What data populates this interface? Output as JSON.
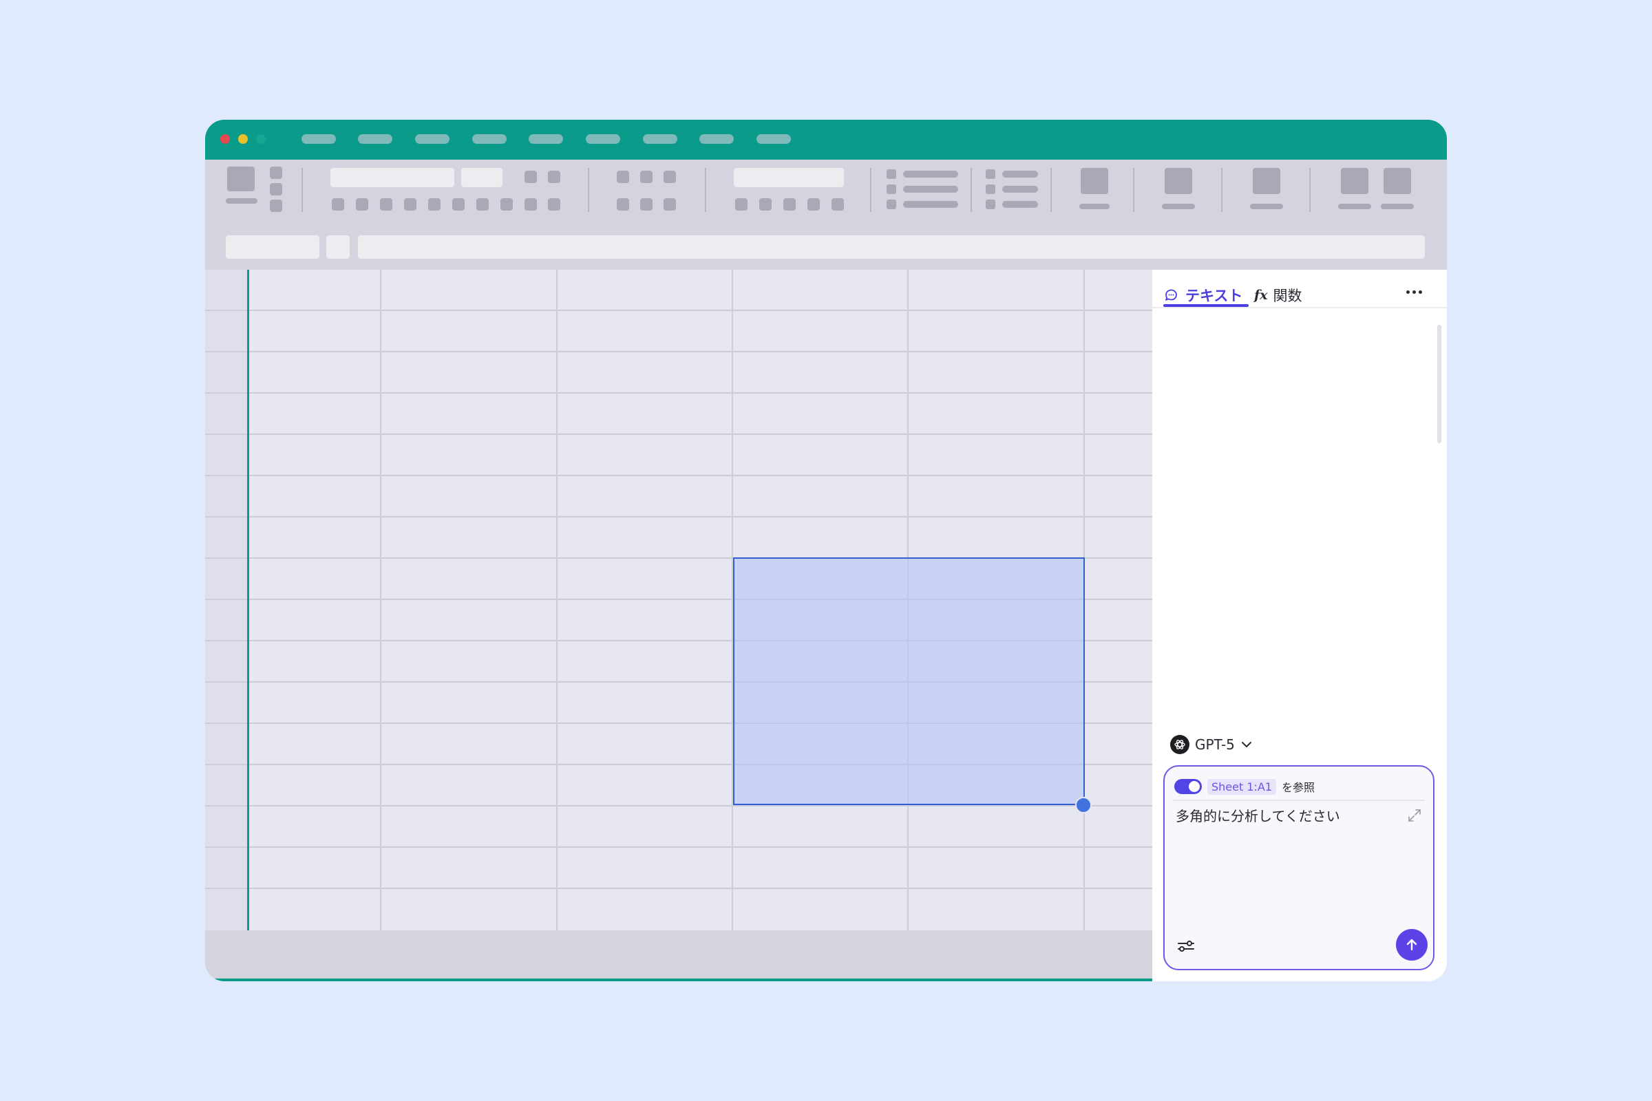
{
  "window": {
    "traffic_lights": [
      "#e5484d",
      "#e9c22b",
      "#16a693"
    ],
    "menu_pill_count": 9
  },
  "grid": {
    "selection": "E8:F13"
  },
  "panel": {
    "tabs": [
      {
        "label": "テキスト",
        "icon": "chat-bubble-icon",
        "active": true
      },
      {
        "label": "関数",
        "icon": "function-fx-icon",
        "active": false
      }
    ],
    "more_icon": "more-horizontal-icon",
    "model": {
      "label": "GPT-5",
      "icon": "openai-logo-icon"
    },
    "composer": {
      "toggle_on": true,
      "context_chip": "Sheet 1:A1",
      "context_suffix": "を参照",
      "prompt_text": "多角的に分析してください",
      "send_icon": "arrow-up-icon",
      "settings_icon": "sliders-icon",
      "expand_icon": "expand-icon"
    }
  },
  "colors": {
    "titlebar": "#0b9b8a",
    "accent": "#5146e5",
    "selection_border": "#2f5fd3",
    "page_background": "#e0eafd"
  }
}
